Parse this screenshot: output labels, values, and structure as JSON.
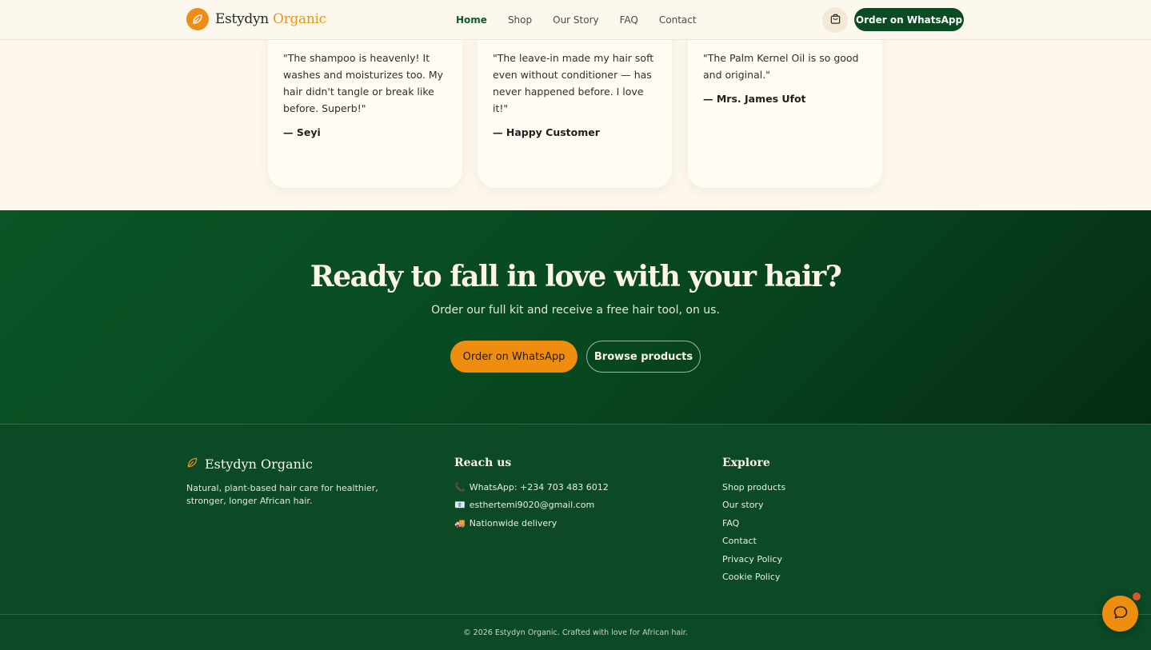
{
  "header": {
    "brand_primary": "Estydyn",
    "brand_accent": "Organic",
    "nav": [
      {
        "label": "Home",
        "active": true
      },
      {
        "label": "Shop"
      },
      {
        "label": "Our Story"
      },
      {
        "label": "FAQ"
      },
      {
        "label": "Contact"
      }
    ],
    "cart_icon": "shopping-bag-icon",
    "order_button": "Order on WhatsApp"
  },
  "testimonials": [
    {
      "quote": "\"The shampoo is heavenly! It washes and moisturizes too. My hair didn't tangle or break like before. Superb!\"",
      "author": "— Seyi"
    },
    {
      "quote": "\"The leave-in made my hair soft even without conditioner — has never happened before. I love it!\"",
      "author": "— Happy Customer"
    },
    {
      "quote": "\"The Palm Kernel Oil is so good and original.\"",
      "author": "— Mrs. James Ufot"
    }
  ],
  "cta": {
    "title": "Ready to fall in love with your hair?",
    "subtitle": "Order our full kit and receive a free hair tool, on us.",
    "primary_button": "Order on WhatsApp",
    "secondary_button": "Browse products"
  },
  "footer": {
    "brand": "Estydyn Organic",
    "description": "Natural, plant-based hair care for healthier, stronger, longer African hair.",
    "reach_heading": "Reach us",
    "reach_items": [
      {
        "icon": "📞",
        "text": "WhatsApp: +234 703 483 6012"
      },
      {
        "icon": "📧",
        "text": "esthertemi9020@gmail.com"
      },
      {
        "icon": "🚚",
        "text": "Nationwide delivery"
      }
    ],
    "explore_heading": "Explore",
    "explore_links": [
      "Shop products",
      "Our story",
      "FAQ",
      "Contact",
      "Privacy Policy",
      "Cookie Policy"
    ],
    "copyright": "© 2026 Estydyn Organic. Crafted with love for African hair."
  },
  "colors": {
    "brand_green": "#0b4a25",
    "accent_orange": "#ee8d0e",
    "cream": "#fdf7ec"
  }
}
